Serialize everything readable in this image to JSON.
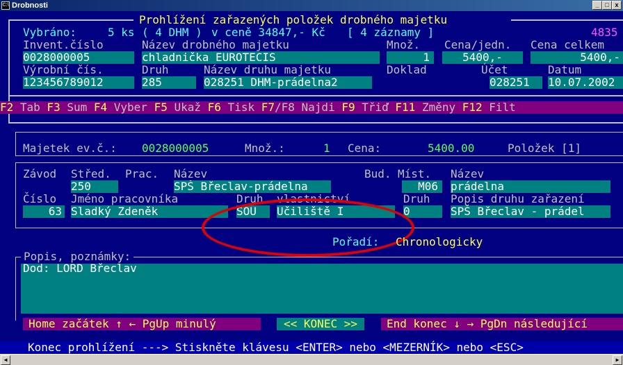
{
  "window": {
    "title": "Drobnosti",
    "icon_text": "C:\\",
    "icon": "console-icon",
    "buttons": [
      "_",
      "□",
      "x"
    ]
  },
  "header": {
    "title": "Prohlížení zařazených položek drobného majetku",
    "selected_prefix": "Vybráno:",
    "selected_count": "5 ks",
    "selected_dhm": "( 4 DHM )",
    "selected_price": "v ceně 34847,- Kč",
    "selected_records": "[ 4 záznamy ]",
    "right_number": "4835"
  },
  "record": {
    "labels": {
      "inv": "Invent.číslo",
      "name": "Název drobného majetku",
      "qty": "Množ.",
      "unit_price": "Cena/jedn.",
      "total": "Cena celkem",
      "serial": "Výrobní čís.",
      "kind": "Druh",
      "kind_name": "Název druhu majetku",
      "doc": "Doklad",
      "account": "Účet",
      "date": "Datum"
    },
    "values": {
      "inv": "0028000005",
      "name": "chladnička EUROTECIS",
      "qty": "1",
      "unit_price": "5400,-",
      "total": "5400,-",
      "serial": "123456789012",
      "kind": "285",
      "kind_name": "028251 DHM-prádelna2",
      "doc": "",
      "account": "028251",
      "date": "10.07.2002"
    }
  },
  "fkeys": [
    {
      "key": "F2",
      "label": "Tab"
    },
    {
      "key": "F3",
      "label": "Sum"
    },
    {
      "key": "F4",
      "label": "Vyber"
    },
    {
      "key": "F5",
      "label": "Ukaž"
    },
    {
      "key": "F6",
      "label": "Tisk"
    },
    {
      "key": "F7",
      "label": "/F8 Najdi"
    },
    {
      "key": "F9",
      "label": "Třiď"
    },
    {
      "key": "F11",
      "label": "Změny"
    },
    {
      "key": "F12",
      "label": "Filt"
    }
  ],
  "summary": {
    "label_asset": "Majetek ev.č.:",
    "asset_no": "0028000005",
    "label_qty": "Množ.:",
    "qty": "1",
    "label_price": "Cena:",
    "price": "5400.00",
    "items": "Položek [1]"
  },
  "location": {
    "labels": {
      "plant": "Závod",
      "center": "Střed.",
      "workplace": "Prac.",
      "name": "Název",
      "building": "Bud.",
      "room": "Míst.",
      "room_name": "Název",
      "number": "Číslo",
      "worker": "Jméno pracovníka",
      "ownership_kind": "Druh",
      "ownership": "vlastnictví",
      "kind": "Druh",
      "kind_desc": "Popis druhu zařazení"
    },
    "values": {
      "plant": "",
      "center": "250",
      "workplace": "",
      "name": "SPŠ Břeclav-prádelna",
      "building": "",
      "room": "M06",
      "room_name": "prádelna",
      "number": "63",
      "worker": "Sladký Zdeněk",
      "ownership_code": "SOU",
      "ownership_name": "Učiliště I",
      "kind": "0",
      "kind_desc": "SPŠ Břeclav - prádel"
    }
  },
  "order": {
    "label": "Pořadí:",
    "value": "Chronologicky"
  },
  "notes": {
    "label": "Popis, poznámky:",
    "value": "Dod: LORD Břeclav"
  },
  "nav": {
    "home": "Home začátek ↑ ← PgUp minulý",
    "konec": "<< KONEC >>",
    "end": "End konec ↓ → PgDn následující"
  },
  "status_text": "Konec prohlížení ---> Stiskněte klávesu <ENTER> nebo <MEZERNÍK> nebo <ESC>",
  "colors": {
    "background": "#000080",
    "field": "#008080",
    "label": "#c0c0c0",
    "title": "#ffff55",
    "highlight": "#55ffff",
    "annotation": "#e00000"
  }
}
